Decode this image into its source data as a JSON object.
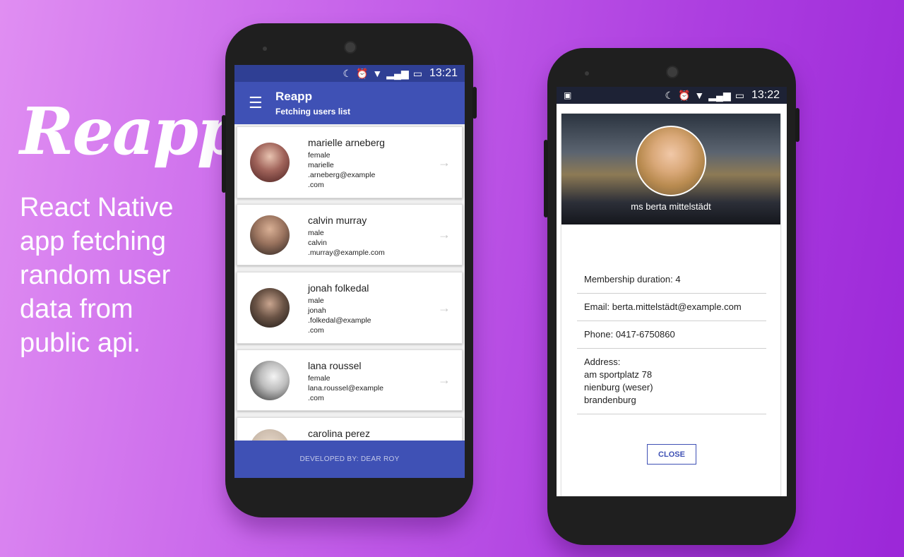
{
  "promo": {
    "title": "Reapp",
    "tagline": "React Native app fetching random user data from public api."
  },
  "left_phone": {
    "status_time": "13:21",
    "toolbar": {
      "title": "Reapp",
      "subtitle": "Fetching users list"
    },
    "users": [
      {
        "name": "marielle arneberg",
        "lines": [
          "female",
          "marielle",
          ".arneberg@example",
          ".com"
        ],
        "avatar_color": "#6b3b3b"
      },
      {
        "name": "calvin murray",
        "lines": [
          "male",
          "calvin",
          ".murray@example.com"
        ],
        "avatar_color": "#8a6b58"
      },
      {
        "name": "jonah folkedal",
        "lines": [
          "male",
          "jonah",
          ".folkedal@example",
          ".com"
        ],
        "avatar_color": "#4c3e35"
      },
      {
        "name": "lana roussel",
        "lines": [
          "female",
          "lana.roussel@example",
          ".com"
        ],
        "avatar_color": "#8e8e8e"
      },
      {
        "name": "carolina perez",
        "lines": [],
        "avatar_color": "#c9b9a9"
      }
    ],
    "footer": "DEVELOPED BY: DEAR ROY"
  },
  "right_phone": {
    "status_time": "13:22",
    "profile_name": "ms berta mittelstädt",
    "membership": "Membership duration: 4",
    "email": "Email: berta.mittelstädt@example.com",
    "phone": "Phone: 0417-6750860",
    "address_label": "Address:",
    "address_lines": [
      "am sportplatz 78",
      "nienburg (weser)",
      "brandenburg"
    ],
    "close_label": "CLOSE"
  },
  "colors": {
    "primary": "#3f51b5",
    "status_dark": "#2f3f94"
  },
  "icons": {
    "menu": "hamburger-icon",
    "arrow": "arrow-right-icon"
  }
}
